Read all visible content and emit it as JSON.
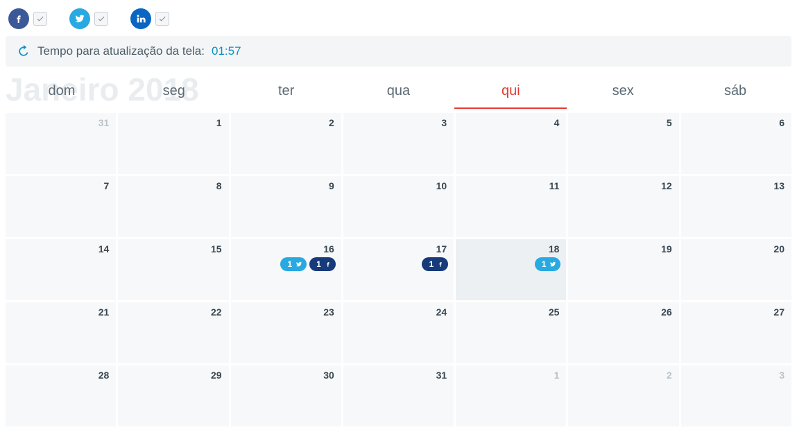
{
  "social": {
    "networks": [
      {
        "key": "facebook",
        "checked": true
      },
      {
        "key": "twitter",
        "checked": true
      },
      {
        "key": "linkedin",
        "checked": true
      }
    ]
  },
  "refresh": {
    "label": "Tempo para atualização da tela:",
    "timer": "01:57"
  },
  "calendar": {
    "month_label": "Janeiro 2018",
    "weekdays": [
      "dom",
      "seg",
      "ter",
      "qua",
      "qui",
      "sex",
      "sáb"
    ],
    "today_weekday_index": 4,
    "cells": [
      {
        "day": "31",
        "other": true
      },
      {
        "day": "1"
      },
      {
        "day": "2"
      },
      {
        "day": "3"
      },
      {
        "day": "4"
      },
      {
        "day": "5"
      },
      {
        "day": "6"
      },
      {
        "day": "7"
      },
      {
        "day": "8"
      },
      {
        "day": "9"
      },
      {
        "day": "10"
      },
      {
        "day": "11"
      },
      {
        "day": "12"
      },
      {
        "day": "13"
      },
      {
        "day": "14"
      },
      {
        "day": "15"
      },
      {
        "day": "16",
        "badges": [
          {
            "network": "twitter",
            "count": "1"
          },
          {
            "network": "facebook",
            "count": "1"
          }
        ]
      },
      {
        "day": "17",
        "badges": [
          {
            "network": "facebook",
            "count": "1"
          }
        ]
      },
      {
        "day": "18",
        "today": true,
        "badges": [
          {
            "network": "twitter",
            "count": "1"
          }
        ]
      },
      {
        "day": "19"
      },
      {
        "day": "20"
      },
      {
        "day": "21"
      },
      {
        "day": "22"
      },
      {
        "day": "23"
      },
      {
        "day": "24"
      },
      {
        "day": "25"
      },
      {
        "day": "26"
      },
      {
        "day": "27"
      },
      {
        "day": "28"
      },
      {
        "day": "29"
      },
      {
        "day": "30"
      },
      {
        "day": "31"
      },
      {
        "day": "1",
        "other": true
      },
      {
        "day": "2",
        "other": true
      },
      {
        "day": "3",
        "other": true
      }
    ]
  }
}
